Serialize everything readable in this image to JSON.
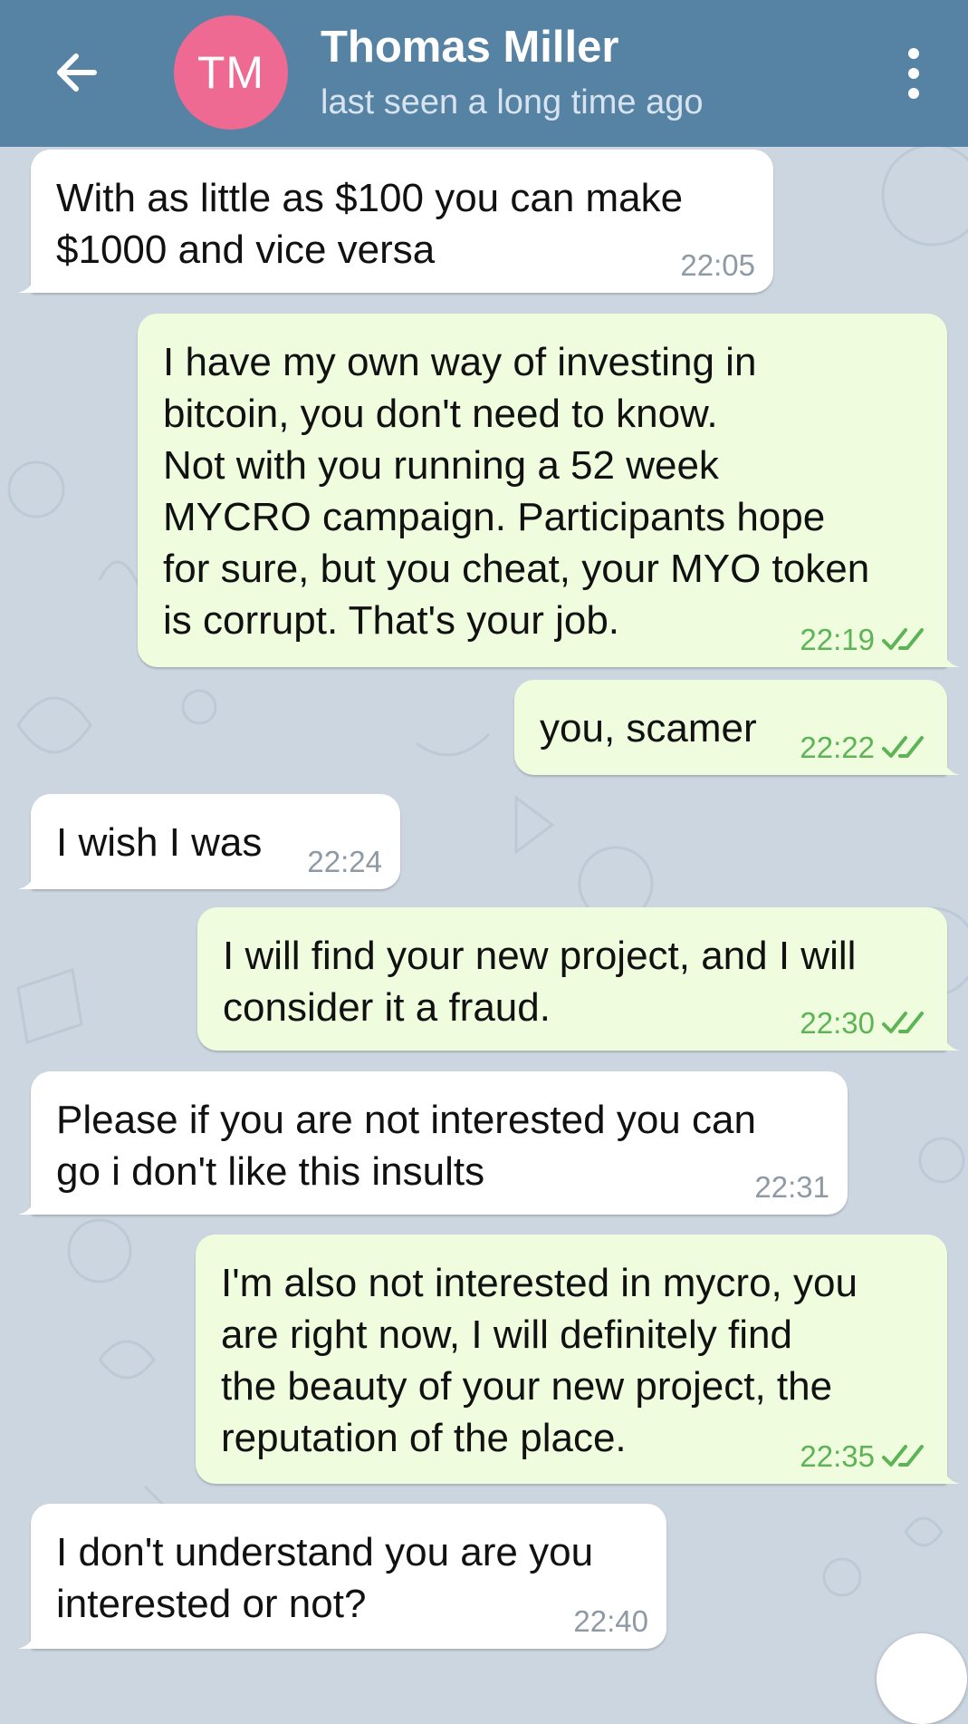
{
  "header": {
    "avatar_initials": "TM",
    "contact_name": "Thomas Miller",
    "status": "last seen a long time ago"
  },
  "colors": {
    "header_bg": "#5682a3",
    "avatar_bg": "#ee6a92",
    "chat_bg": "#cbd6e0",
    "incoming_bubble": "#ffffff",
    "outgoing_bubble": "#effdde",
    "outgoing_time": "#5eb356"
  },
  "messages": [
    {
      "direction": "in",
      "text": "With as little as $100 you can make\n$1000 and vice versa",
      "time": "22:05"
    },
    {
      "direction": "out",
      "text": "I have my own way of investing in\nbitcoin, you don't need to know.\nNot with you running a 52 week\nMYCRO campaign. Participants hope\nfor sure, but you cheat, your MYO token\nis corrupt. That's your job.",
      "time": "22:19",
      "status": "read"
    },
    {
      "direction": "out",
      "text": "you, scamer",
      "time": "22:22",
      "status": "read"
    },
    {
      "direction": "in",
      "text": "I wish I was",
      "time": "22:24"
    },
    {
      "direction": "out",
      "text": "I will find your new project, and I will\nconsider it a fraud.",
      "time": "22:30",
      "status": "read"
    },
    {
      "direction": "in",
      "text": "Please if you are not interested you can\ngo i don't like this insults",
      "time": "22:31"
    },
    {
      "direction": "out",
      "text": "I'm also not interested in mycro, you\nare right now, I will definitely find\nthe beauty of your new project, the\nreputation of the place.",
      "time": "22:35",
      "status": "read"
    },
    {
      "direction": "in",
      "text": "I don't understand you are you\ninterested or not?",
      "time": "22:40"
    }
  ]
}
